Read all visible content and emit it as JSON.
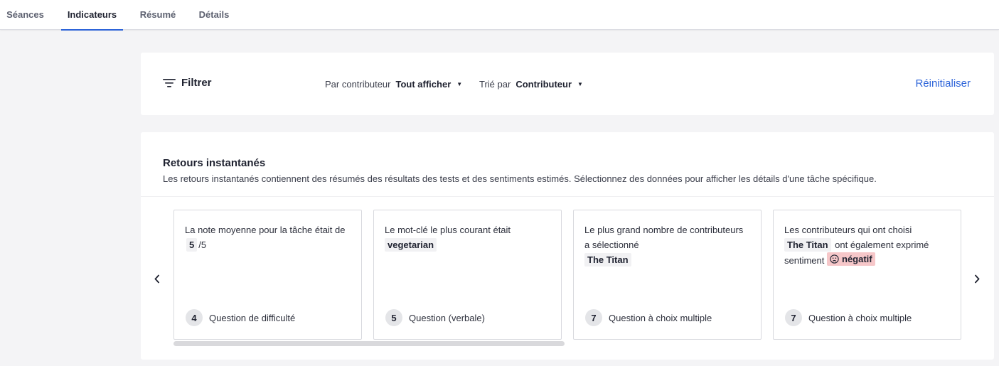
{
  "tabs": [
    {
      "label": "Séances",
      "active": false
    },
    {
      "label": "Indicateurs",
      "active": true
    },
    {
      "label": "Résumé",
      "active": false
    },
    {
      "label": "Détails",
      "active": false
    }
  ],
  "filter": {
    "title": "Filtrer",
    "by_contributor_label": "Par contributeur",
    "by_contributor_value": "Tout afficher",
    "sort_label": "Trié par",
    "sort_value": "Contributeur",
    "reset": "Réinitialiser"
  },
  "feedback": {
    "title": "Retours instantanés",
    "description": "Les retours instantanés contiennent des résumés des résultats des tests et des sentiments estimés. Sélectionnez des données pour afficher les détails d'une tâche spécifique.",
    "cards": [
      {
        "text_a": "La note moyenne pour la tâche était de",
        "chip": "5",
        "text_b": "/5",
        "num": "4",
        "question": "Question de difficulté"
      },
      {
        "text_a": "Le mot-clé le plus courant était",
        "chip": "vegetarian",
        "num": "5",
        "question": "Question (verbale)"
      },
      {
        "text_a": "Le plus grand nombre de contributeurs a sélectionné",
        "chip": "The Titan",
        "num": "7",
        "question": "Question à choix multiple"
      },
      {
        "text_a": "Les contributeurs qui ont choisi",
        "chip": "The Titan",
        "text_b": "ont également exprimé sentiment",
        "sentiment": "négatif",
        "num": "7",
        "question": "Question à choix multiple"
      }
    ]
  },
  "colors": {
    "accent": "#2d64d9",
    "negative_bg": "#f6c7c9"
  }
}
